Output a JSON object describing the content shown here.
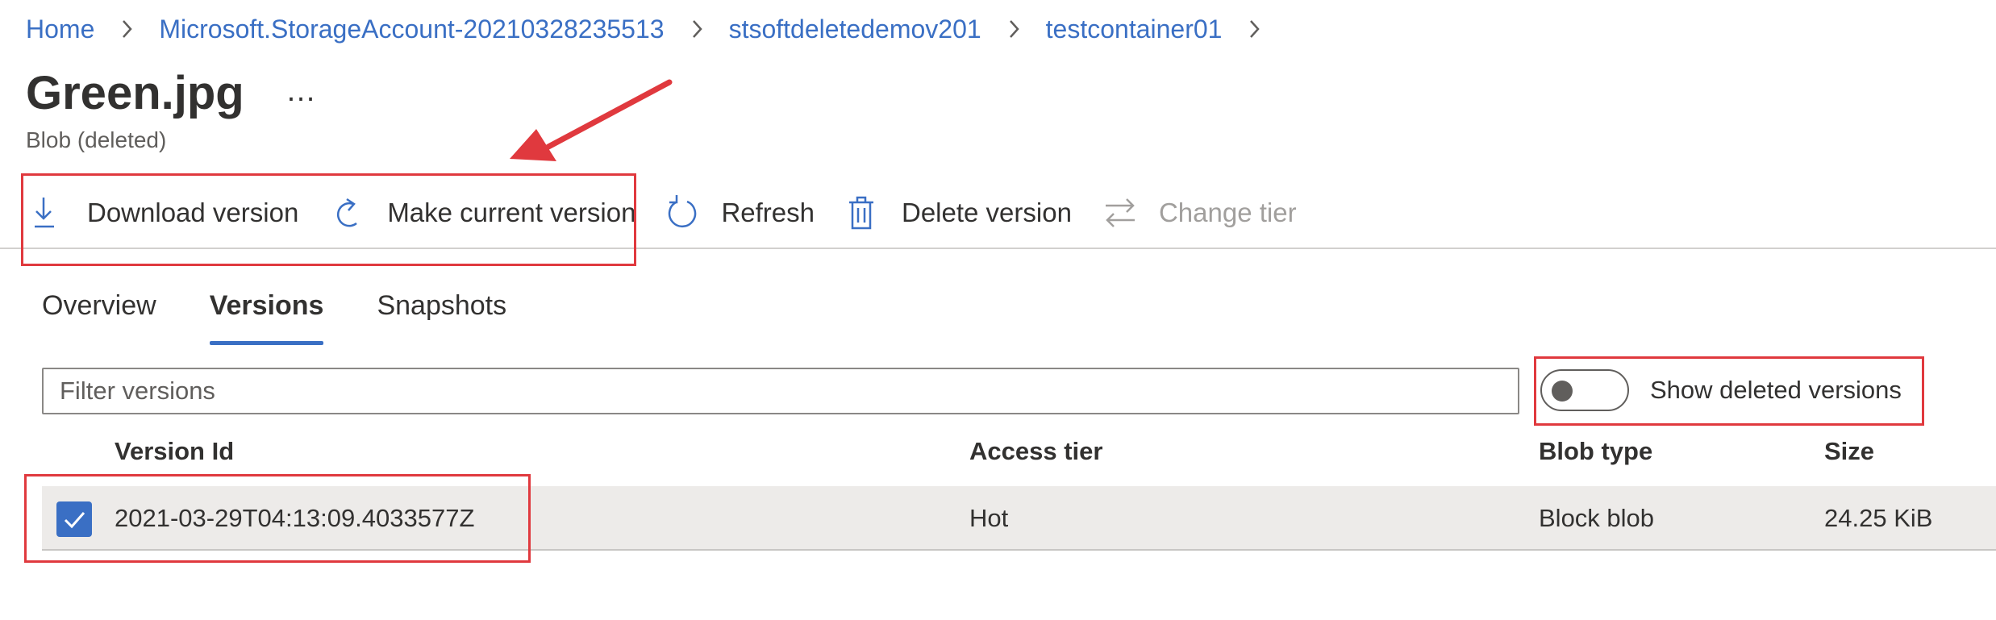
{
  "breadcrumb": {
    "items": [
      "Home",
      "Microsoft.StorageAccount-20210328235513",
      "stsoftdeletedemov201",
      "testcontainer01"
    ]
  },
  "header": {
    "title": "Green.jpg",
    "more": "…",
    "subtitle": "Blob (deleted)"
  },
  "toolbar": {
    "download": "Download version",
    "make_current": "Make current version",
    "refresh": "Refresh",
    "delete": "Delete version",
    "change_tier": "Change tier"
  },
  "tabs": [
    "Overview",
    "Versions",
    "Snapshots"
  ],
  "active_tab": "Versions",
  "filter": {
    "placeholder": "Filter versions",
    "value": ""
  },
  "toggle": {
    "label": "Show deleted versions",
    "on": false
  },
  "table": {
    "columns": [
      "Version Id",
      "Access tier",
      "Blob type",
      "Size"
    ],
    "rows": [
      {
        "selected": true,
        "version_id": "2021-03-29T04:13:09.4033577Z",
        "access_tier": "Hot",
        "blob_type": "Block blob",
        "size": "24.25 KiB"
      }
    ]
  },
  "colors": {
    "link": "#3a6fc4",
    "accent": "#3a6fc4",
    "annotation": "#e0393e",
    "row_selected_bg": "#edebe9"
  },
  "icons": [
    "chevron-right-icon",
    "download-icon",
    "redo-icon",
    "refresh-icon",
    "trash-icon",
    "swap-arrows-icon",
    "checkmark-icon",
    "toggle-off-icon"
  ]
}
